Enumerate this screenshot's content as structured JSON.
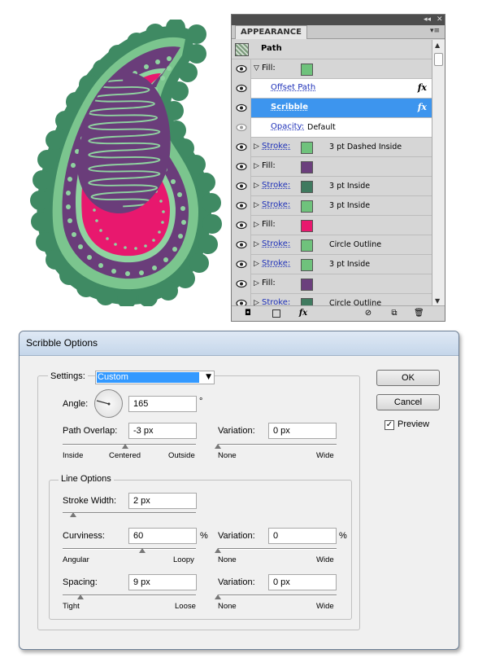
{
  "appearance": {
    "tab": "APPEARANCE",
    "header_label": "Path",
    "rows": [
      {
        "label": "Fill:",
        "swatch": "#6fc27c",
        "value": "",
        "fx": false,
        "style": "plain",
        "arrow": "▽"
      },
      {
        "label": "Offset Path",
        "swatch": "",
        "value": "",
        "fx": true,
        "style": "white-link",
        "arrow": ""
      },
      {
        "label": "Scribble",
        "swatch": "",
        "value": "",
        "fx": true,
        "style": "selected",
        "arrow": ""
      },
      {
        "label": "Opacity:",
        "swatch": "",
        "value": "Default",
        "fx": false,
        "style": "white-link",
        "arrow": ""
      },
      {
        "label": "Stroke:",
        "swatch": "#6fc27c",
        "value": "3 pt Dashed Inside",
        "fx": false,
        "style": "link",
        "arrow": "▷"
      },
      {
        "label": "Fill:",
        "swatch": "#6b3f7d",
        "value": "",
        "fx": false,
        "style": "plain",
        "arrow": "▷"
      },
      {
        "label": "Stroke:",
        "swatch": "#3f7a5f",
        "value": "3 pt  Inside",
        "fx": false,
        "style": "link",
        "arrow": "▷"
      },
      {
        "label": "Stroke:",
        "swatch": "#6fc27c",
        "value": "3 pt  Inside",
        "fx": false,
        "style": "link",
        "arrow": "▷"
      },
      {
        "label": "Fill:",
        "swatch": "#e8186e",
        "value": "",
        "fx": false,
        "style": "plain",
        "arrow": "▷"
      },
      {
        "label": "Stroke:",
        "swatch": "#6fc27c",
        "value": "Circle Outline",
        "fx": false,
        "style": "link",
        "arrow": "▷"
      },
      {
        "label": "Stroke:",
        "swatch": "#6fc27c",
        "value": "3 pt  Inside",
        "fx": false,
        "style": "link",
        "arrow": "▷"
      },
      {
        "label": "Fill:",
        "swatch": "#6b3f7d",
        "value": "",
        "fx": false,
        "style": "plain",
        "arrow": "▷"
      },
      {
        "label": "Stroke:",
        "swatch": "#3f7a5f",
        "value": "Circle Outline",
        "fx": false,
        "style": "link",
        "arrow": "▷"
      }
    ],
    "bottom_icons": [
      "new-art-icon",
      "clear-icon",
      "fx-menu-icon",
      "no-icon",
      "duplicate-icon",
      "trash-icon"
    ]
  },
  "dialog": {
    "title": "Scribble Options",
    "settings_label": "Settings:",
    "settings_value": "Custom",
    "angle_label": "Angle:",
    "angle_value": "165",
    "angle_unit": "°",
    "path_overlap_label": "Path Overlap:",
    "path_overlap_value": "-3 px",
    "path_overlap_scale": [
      "Inside",
      "Centered",
      "Outside"
    ],
    "path_overlap_slider": 0.47,
    "variation_label": "Variation:",
    "overlap_variation_value": "0 px",
    "none_label": "None",
    "wide_label": "Wide",
    "line_options_label": "Line Options",
    "stroke_width_label": "Stroke Width:",
    "stroke_width_value": "2 px",
    "curviness_label": "Curviness:",
    "curviness_value": "60",
    "percent": "%",
    "curviness_variation_value": "0",
    "curviness_scale": [
      "Angular",
      "Loopy"
    ],
    "spacing_label": "Spacing:",
    "spacing_value": "9 px",
    "spacing_scale": [
      "Tight",
      "Loose"
    ],
    "spacing_variation_value": "0 px",
    "ok_label": "OK",
    "cancel_label": "Cancel",
    "preview_label": "Preview",
    "preview_checked": true
  }
}
